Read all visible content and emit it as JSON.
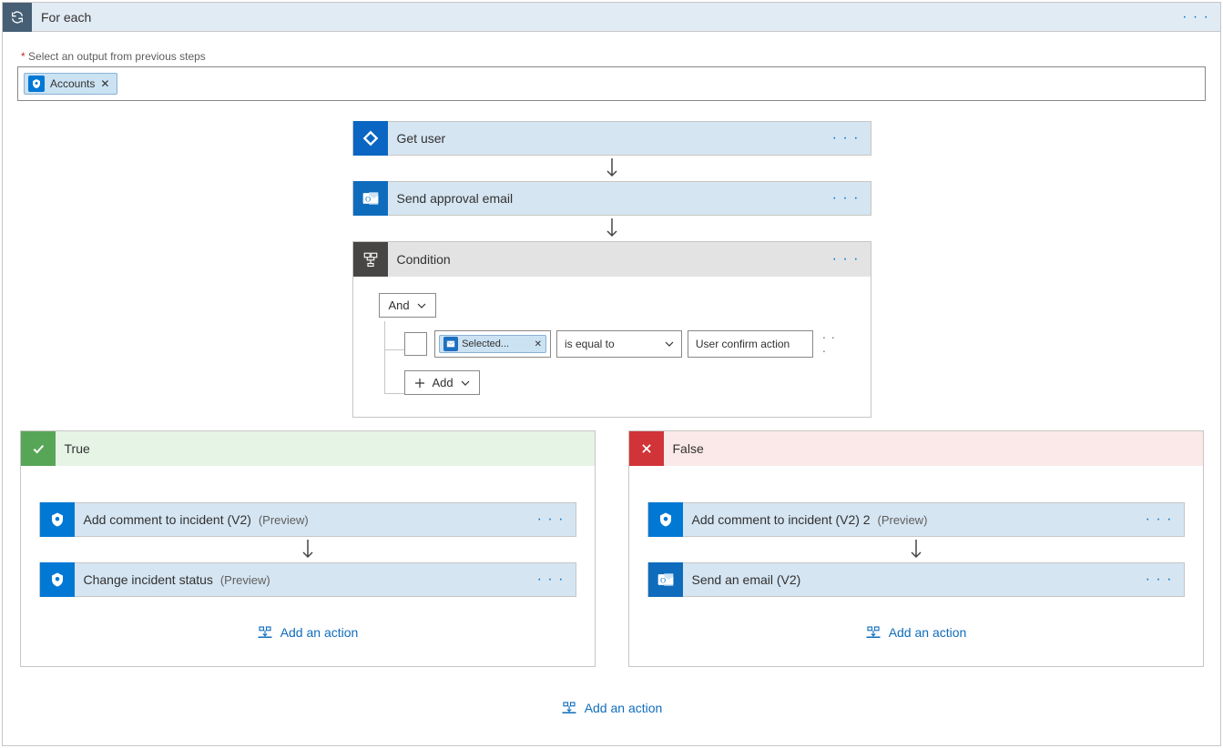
{
  "foreach": {
    "title": "For each",
    "required_label": "Select an output from previous steps",
    "pill_label": "Accounts"
  },
  "steps": {
    "get_user": "Get user",
    "send_approval": "Send approval email",
    "condition": "Condition"
  },
  "condition": {
    "group_op": "And",
    "token": "Selected...",
    "operator": "is equal to",
    "value": "User confirm action",
    "add_label": "Add"
  },
  "branches": {
    "true_label": "True",
    "false_label": "False",
    "true_steps": {
      "a": {
        "title": "Add comment to incident (V2)",
        "preview": "(Preview)"
      },
      "b": {
        "title": "Change incident status",
        "preview": "(Preview)"
      }
    },
    "false_steps": {
      "a": {
        "title": "Add comment to incident (V2) 2",
        "preview": "(Preview)"
      },
      "b": {
        "title": "Send an email (V2)",
        "preview": ""
      }
    }
  },
  "add_action_label": "Add an action"
}
